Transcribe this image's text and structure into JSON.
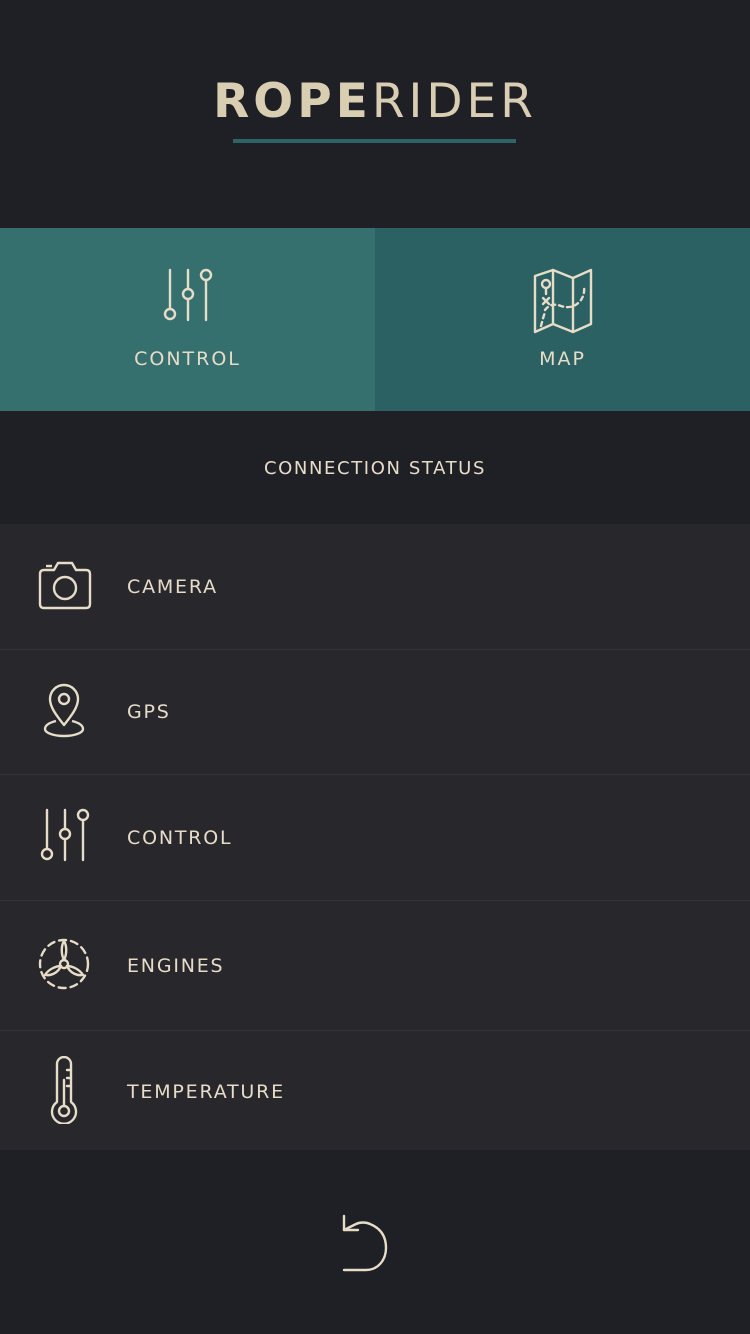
{
  "app": {
    "logo_bold": "ROPE",
    "logo_thin": "RIDER"
  },
  "tabs": [
    {
      "label": "CONTROL",
      "icon": "sliders-icon"
    },
    {
      "label": "MAP",
      "icon": "map-icon"
    }
  ],
  "section": {
    "title": "CONNECTION STATUS"
  },
  "status_items": [
    {
      "label": "CAMERA",
      "icon": "camera-icon"
    },
    {
      "label": "GPS",
      "icon": "location-pin-icon"
    },
    {
      "label": "CONTROL",
      "icon": "sliders-icon"
    },
    {
      "label": "ENGINES",
      "icon": "propeller-icon"
    },
    {
      "label": "TEMPERATURE",
      "icon": "thermometer-icon"
    }
  ],
  "footer": {
    "back_icon": "back-arrow-icon"
  },
  "colors": {
    "background": "#1f2025",
    "list_background": "#27272c",
    "tab_control": "#35706f",
    "tab_map": "#2b6163",
    "accent_line": "#2e6466",
    "text": "#e6dcc8"
  }
}
